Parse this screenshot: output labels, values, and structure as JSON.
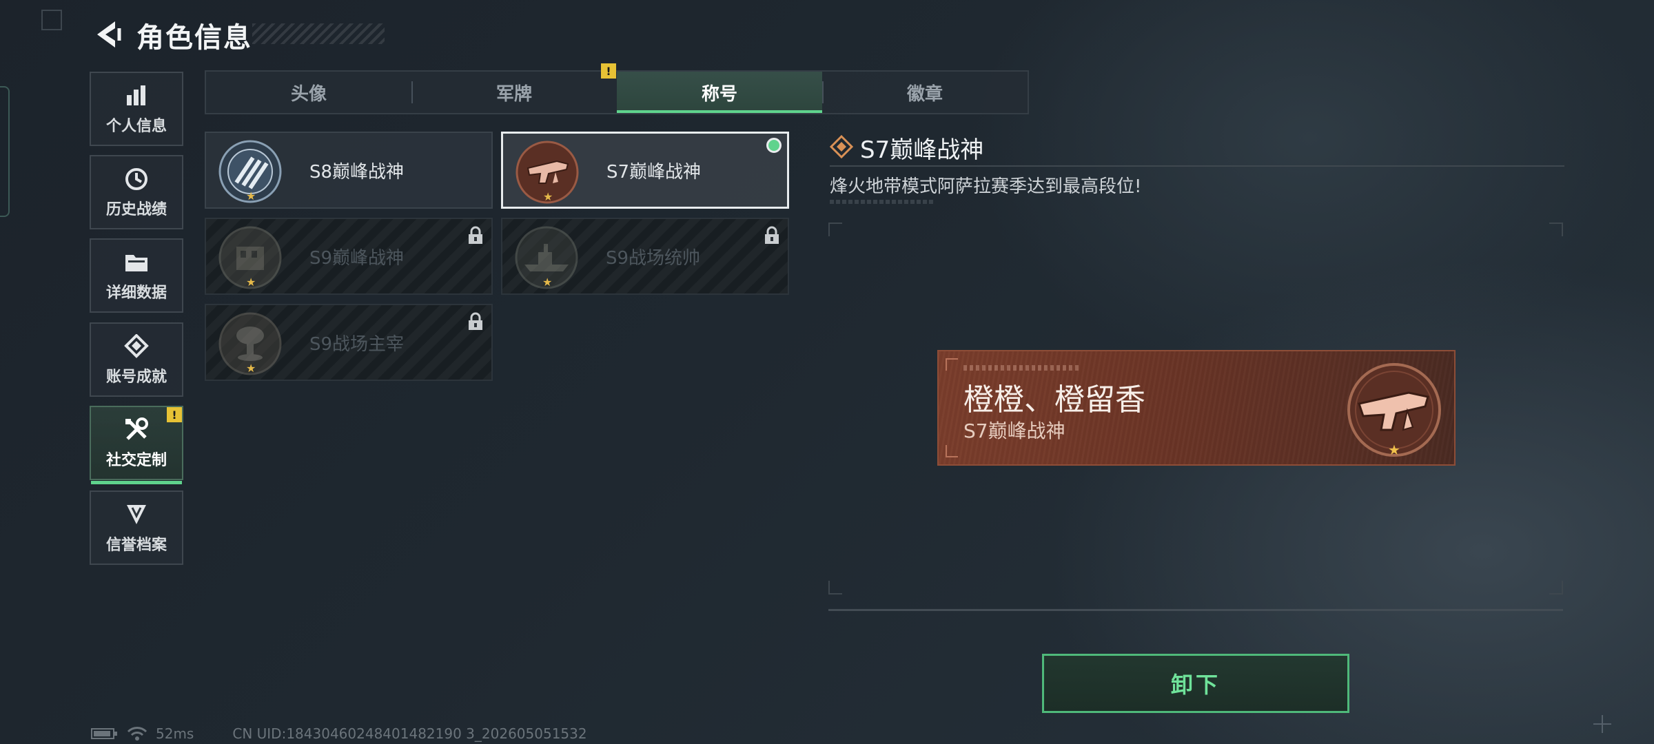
{
  "header": {
    "title": "角色信息"
  },
  "sidebar": {
    "items": [
      {
        "label": "个人信息",
        "icon": "bar-chart-icon"
      },
      {
        "label": "历史战绩",
        "icon": "history-icon"
      },
      {
        "label": "详细数据",
        "icon": "folder-icon"
      },
      {
        "label": "账号成就",
        "icon": "achievement-icon"
      },
      {
        "label": "社交定制",
        "icon": "tools-icon",
        "badge": "!",
        "active": true
      },
      {
        "label": "信誉档案",
        "icon": "reputation-icon"
      }
    ]
  },
  "tabs": [
    {
      "label": "头像"
    },
    {
      "label": "军牌",
      "badge": "!"
    },
    {
      "label": "称号",
      "active": true
    },
    {
      "label": "徽章"
    }
  ],
  "titles": [
    {
      "name": "S8巅峰战神",
      "locked": false,
      "selected": false,
      "equipped": false
    },
    {
      "name": "S7巅峰战神",
      "locked": false,
      "selected": true,
      "equipped": true
    },
    {
      "name": "S9巅峰战神",
      "locked": true
    },
    {
      "name": "S9战场统帅",
      "locked": true
    },
    {
      "name": "S9战场主宰",
      "locked": true
    }
  ],
  "detail": {
    "title": "S7巅峰战神",
    "description": "烽火地带模式阿萨拉赛季达到最高段位!"
  },
  "preview": {
    "player_name": "橙橙、橙留香",
    "title": "S7巅峰战神"
  },
  "actions": {
    "unequip_label": "卸下"
  },
  "status_bar": {
    "ping": "52ms",
    "uid": "CN UID:18430460248401482190 3_202605051532"
  },
  "colors": {
    "accent_green": "#5fd38d",
    "warning_yellow": "#e7c235",
    "banner_brown": "#6c3526"
  }
}
